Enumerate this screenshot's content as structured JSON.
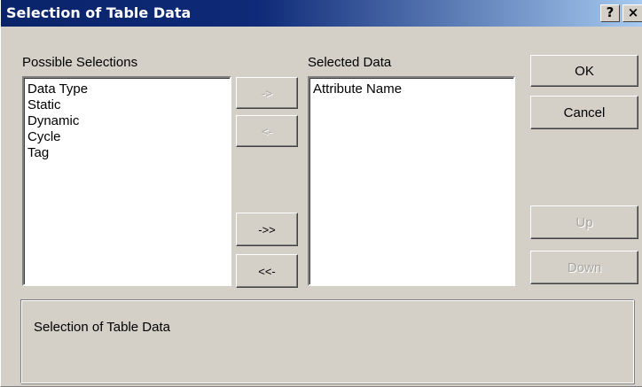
{
  "window": {
    "title": "Selection of Table Data",
    "help_label": "?",
    "close_label": "×"
  },
  "possible": {
    "label": "Possible Selections",
    "items": [
      "Data Type",
      "Static",
      "Dynamic",
      "Cycle",
      "Tag"
    ]
  },
  "selected": {
    "label": "Selected Data",
    "items": [
      "Attribute Name"
    ]
  },
  "transfer": {
    "add_label": "->",
    "remove_label": "<-",
    "add_all_label": "->>",
    "remove_all_label": "<<-"
  },
  "actions": {
    "ok_label": "OK",
    "cancel_label": "Cancel",
    "up_label": "Up",
    "down_label": "Down"
  },
  "status": {
    "text": "Selection of Table Data"
  },
  "colors": {
    "titlebar_start": "#0a246a",
    "titlebar_end": "#a6caf0",
    "face": "#d4d0c8",
    "disabled_text": "#a8a6a0"
  }
}
